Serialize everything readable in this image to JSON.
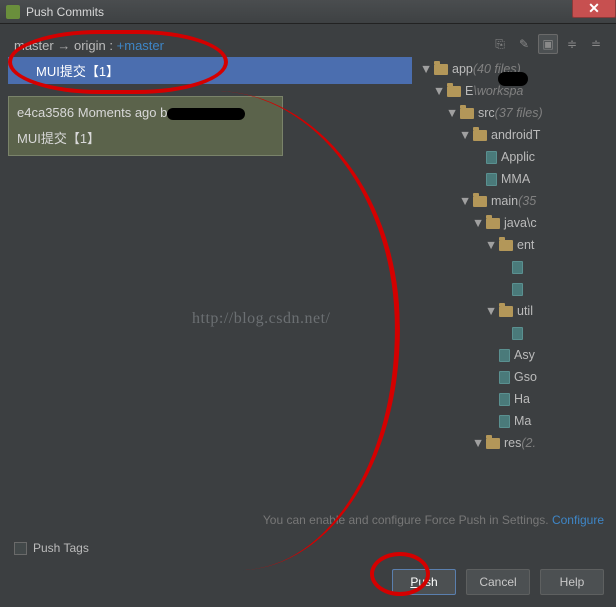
{
  "window": {
    "title": "Push Commits",
    "close_glyph": "✕"
  },
  "branch": {
    "local": "master",
    "arrow": "→",
    "remote": "origin",
    "sep": ":",
    "target": "+master"
  },
  "commit": {
    "label": "MUI提交【1】"
  },
  "tooltip": {
    "hash": "e4ca3586",
    "time": "Moments ago",
    "by_lead": "b",
    "msg": "MUI提交【1】"
  },
  "tree": {
    "rows": [
      {
        "depth": 0,
        "exp": "▼",
        "icon": "folder",
        "label": "app",
        "muted": "(40 files)"
      },
      {
        "depth": 1,
        "exp": "▼",
        "icon": "folder",
        "label": "E",
        "muted": "\\workspa"
      },
      {
        "depth": 2,
        "exp": "▼",
        "icon": "folder",
        "label": "src",
        "muted": "(37 files)"
      },
      {
        "depth": 3,
        "exp": "▼",
        "icon": "folder",
        "label": "androidT",
        "muted": ""
      },
      {
        "depth": 4,
        "exp": "",
        "icon": "file",
        "label": "Applic",
        "muted": ""
      },
      {
        "depth": 4,
        "exp": "",
        "icon": "file",
        "label": "MMA",
        "muted": ""
      },
      {
        "depth": 3,
        "exp": "▼",
        "icon": "folder",
        "label": "main",
        "muted": "(35"
      },
      {
        "depth": 4,
        "exp": "▼",
        "icon": "folder",
        "label": "java\\c",
        "muted": ""
      },
      {
        "depth": 5,
        "exp": "▼",
        "icon": "folder",
        "label": "ent",
        "muted": ""
      },
      {
        "depth": 6,
        "exp": "",
        "icon": "file",
        "label": "",
        "muted": ""
      },
      {
        "depth": 6,
        "exp": "",
        "icon": "file",
        "label": "",
        "muted": ""
      },
      {
        "depth": 5,
        "exp": "▼",
        "icon": "folder",
        "label": "util",
        "muted": ""
      },
      {
        "depth": 6,
        "exp": "",
        "icon": "file",
        "label": "",
        "muted": ""
      },
      {
        "depth": 5,
        "exp": "",
        "icon": "file",
        "label": "Asy",
        "muted": ""
      },
      {
        "depth": 5,
        "exp": "",
        "icon": "file",
        "label": "Gso",
        "muted": ""
      },
      {
        "depth": 5,
        "exp": "",
        "icon": "file",
        "label": "Ha",
        "muted": ""
      },
      {
        "depth": 5,
        "exp": "",
        "icon": "file",
        "label": "Ma",
        "muted": ""
      },
      {
        "depth": 4,
        "exp": "▼",
        "icon": "folder",
        "label": "res",
        "muted": "(2."
      }
    ]
  },
  "hint": {
    "text": "You can enable and configure Force Push in Settings.",
    "link": "Configure"
  },
  "footer": {
    "push_tags_pre": "Push ",
    "push_tags_u": "T",
    "push_tags_post": "ags"
  },
  "buttons": {
    "push_u": "P",
    "push_rest": "ush",
    "cancel": "Cancel",
    "help": "Help"
  },
  "watermark": "http://blog.csdn.net/"
}
